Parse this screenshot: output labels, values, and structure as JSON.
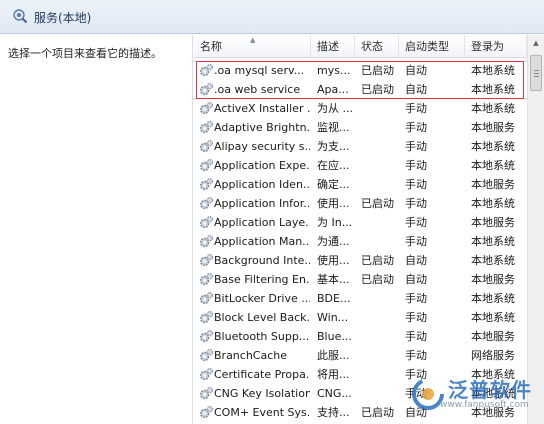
{
  "window": {
    "title": "服务(本地)",
    "icon": "services-gear-search-icon"
  },
  "left_pane": {
    "description": "选择一个项目来查看它的描述。"
  },
  "columns": [
    {
      "key": "name",
      "label": "名称",
      "sorted": "ascending"
    },
    {
      "key": "description",
      "label": "描述"
    },
    {
      "key": "status",
      "label": "状态"
    },
    {
      "key": "startup",
      "label": "启动类型"
    },
    {
      "key": "logon",
      "label": "登录为"
    }
  ],
  "services": [
    {
      "name": ".oa mysql serv...",
      "description": "mys...",
      "status": "已启动",
      "startup": "自动",
      "logon": "本地系统",
      "highlighted": true
    },
    {
      "name": ".oa web service",
      "description": "Apa...",
      "status": "已启动",
      "startup": "自动",
      "logon": "本地系统",
      "highlighted": true
    },
    {
      "name": "ActiveX Installer ...",
      "description": "为从 ...",
      "status": "",
      "startup": "手动",
      "logon": "本地系统"
    },
    {
      "name": "Adaptive Brightn...",
      "description": "监视...",
      "status": "",
      "startup": "手动",
      "logon": "本地服务"
    },
    {
      "name": "Alipay security s...",
      "description": "为支...",
      "status": "",
      "startup": "手动",
      "logon": "本地系统"
    },
    {
      "name": "Application Expe...",
      "description": "在应...",
      "status": "",
      "startup": "手动",
      "logon": "本地系统"
    },
    {
      "name": "Application Iden...",
      "description": "确定...",
      "status": "",
      "startup": "手动",
      "logon": "本地服务"
    },
    {
      "name": "Application Infor...",
      "description": "使用...",
      "status": "已启动",
      "startup": "手动",
      "logon": "本地系统"
    },
    {
      "name": "Application Laye...",
      "description": "为 In...",
      "status": "",
      "startup": "手动",
      "logon": "本地服务"
    },
    {
      "name": "Application Man...",
      "description": "为通...",
      "status": "",
      "startup": "手动",
      "logon": "本地系统"
    },
    {
      "name": "Background Inte...",
      "description": "使用...",
      "status": "已启动",
      "startup": "自动",
      "logon": "本地系统"
    },
    {
      "name": "Base Filtering En...",
      "description": "基本...",
      "status": "已启动",
      "startup": "自动",
      "logon": "本地服务"
    },
    {
      "name": "BitLocker Drive ...",
      "description": "BDE...",
      "status": "",
      "startup": "手动",
      "logon": "本地系统"
    },
    {
      "name": "Block Level Back...",
      "description": "Win...",
      "status": "",
      "startup": "手动",
      "logon": "本地系统"
    },
    {
      "name": "Bluetooth Supp...",
      "description": "Blue...",
      "status": "",
      "startup": "手动",
      "logon": "本地服务"
    },
    {
      "name": "BranchCache",
      "description": "此服...",
      "status": "",
      "startup": "手动",
      "logon": "网络服务"
    },
    {
      "name": "Certificate Propa...",
      "description": "将用...",
      "status": "",
      "startup": "手动",
      "logon": "本地系统"
    },
    {
      "name": "CNG Key Isolation",
      "description": "CNG...",
      "status": "",
      "startup": "手动",
      "logon": "本地系统"
    },
    {
      "name": "COM+ Event Sys...",
      "description": "支持...",
      "status": "已启动",
      "startup": "自动",
      "logon": "本地服务"
    }
  ],
  "watermark": {
    "text": "泛普软件",
    "url": "www.fanpusoft.com"
  },
  "colors": {
    "highlight_border": "#e0333a",
    "header_text": "#1e395b",
    "watermark": "#2f6fbf"
  }
}
